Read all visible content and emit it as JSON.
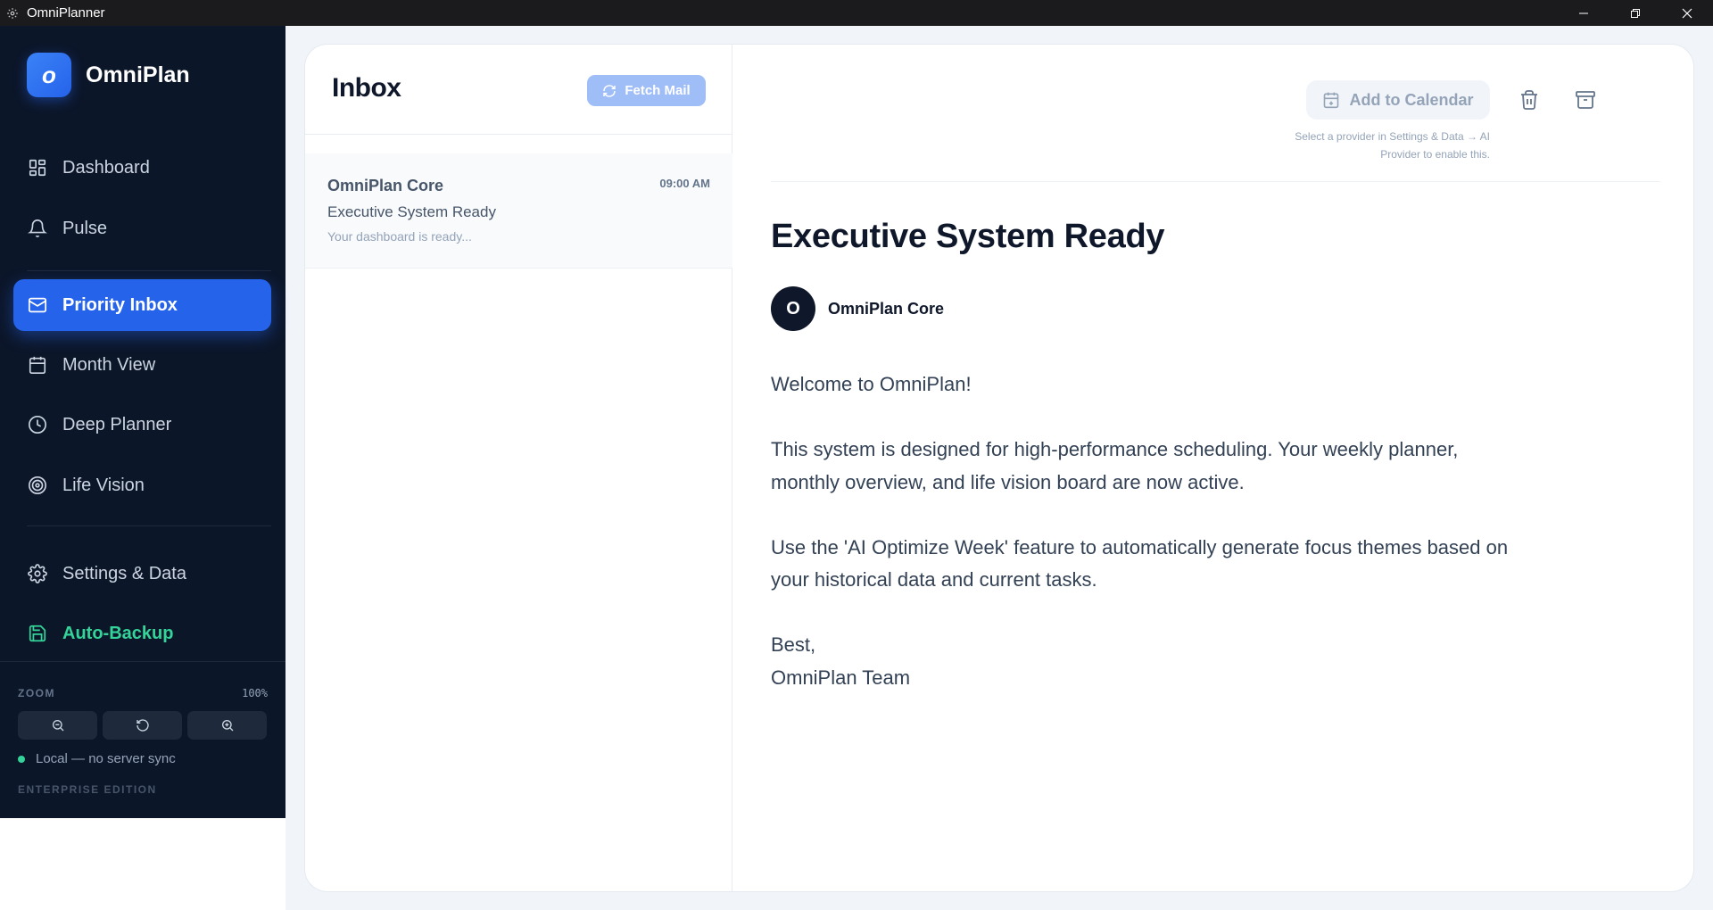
{
  "window": {
    "title": "OmniPlanner"
  },
  "brand": {
    "logo_letter": "o",
    "name": "OmniPlan"
  },
  "nav": {
    "dashboard": "Dashboard",
    "pulse": "Pulse",
    "priority_inbox": "Priority Inbox",
    "month_view": "Month View",
    "deep_planner": "Deep Planner",
    "life_vision": "Life Vision",
    "settings": "Settings & Data",
    "auto_backup": "Auto-Backup"
  },
  "footer": {
    "zoom_label": "ZOOM",
    "zoom_value": "100%",
    "status": "Local — no server sync",
    "edition": "ENTERPRISE EDITION"
  },
  "inbox": {
    "title": "Inbox",
    "fetch_label": "Fetch Mail",
    "items": [
      {
        "from": "OmniPlan Core",
        "time": "09:00 AM",
        "subject": "Executive System Ready",
        "preview": "Your dashboard is ready..."
      }
    ]
  },
  "reader": {
    "add_calendar_label": "Add to Calendar",
    "hint": "Select a provider in Settings & Data → AI Provider to enable this.",
    "subject": "Executive System Ready",
    "sender_initial": "O",
    "sender_name": "OmniPlan Core",
    "paragraphs": [
      "Welcome to OmniPlan!",
      "This system is designed for high-performance scheduling. Your weekly planner, monthly overview, and life vision board are now active.",
      "Use the 'AI Optimize Week' feature to automatically generate focus themes based on your historical data and current tasks."
    ],
    "signoff": "Best,",
    "signature": "OmniPlan Team"
  },
  "colors": {
    "sidebar_bg": "#0c1629",
    "accent": "#2563eb",
    "backup": "#34d399"
  }
}
